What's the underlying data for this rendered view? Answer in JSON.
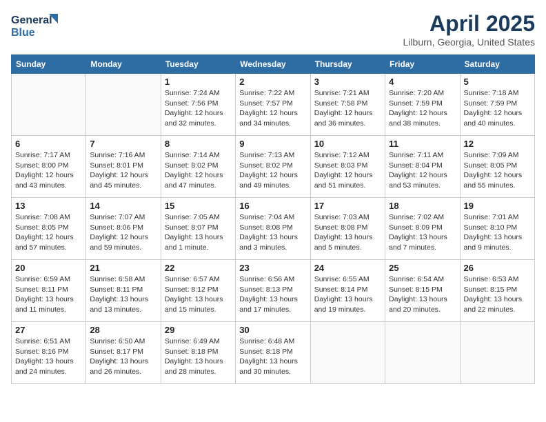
{
  "header": {
    "logo_line1": "General",
    "logo_line2": "Blue",
    "month_title": "April 2025",
    "location": "Lilburn, Georgia, United States"
  },
  "days_of_week": [
    "Sunday",
    "Monday",
    "Tuesday",
    "Wednesday",
    "Thursday",
    "Friday",
    "Saturday"
  ],
  "weeks": [
    [
      {
        "day": "",
        "sunrise": "",
        "sunset": "",
        "daylight": ""
      },
      {
        "day": "",
        "sunrise": "",
        "sunset": "",
        "daylight": ""
      },
      {
        "day": "1",
        "sunrise": "Sunrise: 7:24 AM",
        "sunset": "Sunset: 7:56 PM",
        "daylight": "Daylight: 12 hours and 32 minutes."
      },
      {
        "day": "2",
        "sunrise": "Sunrise: 7:22 AM",
        "sunset": "Sunset: 7:57 PM",
        "daylight": "Daylight: 12 hours and 34 minutes."
      },
      {
        "day": "3",
        "sunrise": "Sunrise: 7:21 AM",
        "sunset": "Sunset: 7:58 PM",
        "daylight": "Daylight: 12 hours and 36 minutes."
      },
      {
        "day": "4",
        "sunrise": "Sunrise: 7:20 AM",
        "sunset": "Sunset: 7:59 PM",
        "daylight": "Daylight: 12 hours and 38 minutes."
      },
      {
        "day": "5",
        "sunrise": "Sunrise: 7:18 AM",
        "sunset": "Sunset: 7:59 PM",
        "daylight": "Daylight: 12 hours and 40 minutes."
      }
    ],
    [
      {
        "day": "6",
        "sunrise": "Sunrise: 7:17 AM",
        "sunset": "Sunset: 8:00 PM",
        "daylight": "Daylight: 12 hours and 43 minutes."
      },
      {
        "day": "7",
        "sunrise": "Sunrise: 7:16 AM",
        "sunset": "Sunset: 8:01 PM",
        "daylight": "Daylight: 12 hours and 45 minutes."
      },
      {
        "day": "8",
        "sunrise": "Sunrise: 7:14 AM",
        "sunset": "Sunset: 8:02 PM",
        "daylight": "Daylight: 12 hours and 47 minutes."
      },
      {
        "day": "9",
        "sunrise": "Sunrise: 7:13 AM",
        "sunset": "Sunset: 8:02 PM",
        "daylight": "Daylight: 12 hours and 49 minutes."
      },
      {
        "day": "10",
        "sunrise": "Sunrise: 7:12 AM",
        "sunset": "Sunset: 8:03 PM",
        "daylight": "Daylight: 12 hours and 51 minutes."
      },
      {
        "day": "11",
        "sunrise": "Sunrise: 7:11 AM",
        "sunset": "Sunset: 8:04 PM",
        "daylight": "Daylight: 12 hours and 53 minutes."
      },
      {
        "day": "12",
        "sunrise": "Sunrise: 7:09 AM",
        "sunset": "Sunset: 8:05 PM",
        "daylight": "Daylight: 12 hours and 55 minutes."
      }
    ],
    [
      {
        "day": "13",
        "sunrise": "Sunrise: 7:08 AM",
        "sunset": "Sunset: 8:05 PM",
        "daylight": "Daylight: 12 hours and 57 minutes."
      },
      {
        "day": "14",
        "sunrise": "Sunrise: 7:07 AM",
        "sunset": "Sunset: 8:06 PM",
        "daylight": "Daylight: 12 hours and 59 minutes."
      },
      {
        "day": "15",
        "sunrise": "Sunrise: 7:05 AM",
        "sunset": "Sunset: 8:07 PM",
        "daylight": "Daylight: 13 hours and 1 minute."
      },
      {
        "day": "16",
        "sunrise": "Sunrise: 7:04 AM",
        "sunset": "Sunset: 8:08 PM",
        "daylight": "Daylight: 13 hours and 3 minutes."
      },
      {
        "day": "17",
        "sunrise": "Sunrise: 7:03 AM",
        "sunset": "Sunset: 8:08 PM",
        "daylight": "Daylight: 13 hours and 5 minutes."
      },
      {
        "day": "18",
        "sunrise": "Sunrise: 7:02 AM",
        "sunset": "Sunset: 8:09 PM",
        "daylight": "Daylight: 13 hours and 7 minutes."
      },
      {
        "day": "19",
        "sunrise": "Sunrise: 7:01 AM",
        "sunset": "Sunset: 8:10 PM",
        "daylight": "Daylight: 13 hours and 9 minutes."
      }
    ],
    [
      {
        "day": "20",
        "sunrise": "Sunrise: 6:59 AM",
        "sunset": "Sunset: 8:11 PM",
        "daylight": "Daylight: 13 hours and 11 minutes."
      },
      {
        "day": "21",
        "sunrise": "Sunrise: 6:58 AM",
        "sunset": "Sunset: 8:11 PM",
        "daylight": "Daylight: 13 hours and 13 minutes."
      },
      {
        "day": "22",
        "sunrise": "Sunrise: 6:57 AM",
        "sunset": "Sunset: 8:12 PM",
        "daylight": "Daylight: 13 hours and 15 minutes."
      },
      {
        "day": "23",
        "sunrise": "Sunrise: 6:56 AM",
        "sunset": "Sunset: 8:13 PM",
        "daylight": "Daylight: 13 hours and 17 minutes."
      },
      {
        "day": "24",
        "sunrise": "Sunrise: 6:55 AM",
        "sunset": "Sunset: 8:14 PM",
        "daylight": "Daylight: 13 hours and 19 minutes."
      },
      {
        "day": "25",
        "sunrise": "Sunrise: 6:54 AM",
        "sunset": "Sunset: 8:15 PM",
        "daylight": "Daylight: 13 hours and 20 minutes."
      },
      {
        "day": "26",
        "sunrise": "Sunrise: 6:53 AM",
        "sunset": "Sunset: 8:15 PM",
        "daylight": "Daylight: 13 hours and 22 minutes."
      }
    ],
    [
      {
        "day": "27",
        "sunrise": "Sunrise: 6:51 AM",
        "sunset": "Sunset: 8:16 PM",
        "daylight": "Daylight: 13 hours and 24 minutes."
      },
      {
        "day": "28",
        "sunrise": "Sunrise: 6:50 AM",
        "sunset": "Sunset: 8:17 PM",
        "daylight": "Daylight: 13 hours and 26 minutes."
      },
      {
        "day": "29",
        "sunrise": "Sunrise: 6:49 AM",
        "sunset": "Sunset: 8:18 PM",
        "daylight": "Daylight: 13 hours and 28 minutes."
      },
      {
        "day": "30",
        "sunrise": "Sunrise: 6:48 AM",
        "sunset": "Sunset: 8:18 PM",
        "daylight": "Daylight: 13 hours and 30 minutes."
      },
      {
        "day": "",
        "sunrise": "",
        "sunset": "",
        "daylight": ""
      },
      {
        "day": "",
        "sunrise": "",
        "sunset": "",
        "daylight": ""
      },
      {
        "day": "",
        "sunrise": "",
        "sunset": "",
        "daylight": ""
      }
    ]
  ]
}
